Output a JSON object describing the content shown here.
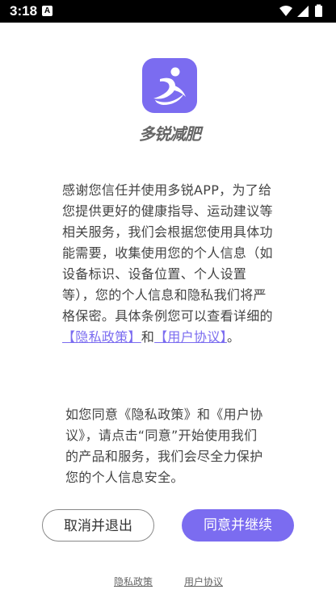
{
  "status_bar": {
    "time": "3:18",
    "notification_icon_letter": "A",
    "icons": [
      "wifi-icon",
      "signal-icon",
      "battery-icon"
    ]
  },
  "app": {
    "brand_name": "多锐减肥",
    "accent_color": "#7b6cf0"
  },
  "intro": {
    "text_before": "感谢您信任并使用多锐APP，为了给您提供更好的健康指导、运动建议等相关服务，我们会根据您使用具体功能需要，收集使用您的个人信息（如设备标识、设备位置、个人设置等），您的个人信息和隐私我们将严格保密。具体条例您可以查看详细的",
    "privacy_link": "【隐私政策】",
    "conjunction": "和",
    "user_link": "【用户协议】",
    "text_after": "。"
  },
  "consent": {
    "text": "如您同意《隐私政策》和《用户协议》，请点击“同意”开始使用我们的产品和服务，我们会尽全力保护您的个人信息安全。"
  },
  "buttons": {
    "cancel_label": "取消并退出",
    "agree_label": "同意并继续"
  },
  "footer": {
    "privacy_label": "隐私政策",
    "user_label": "用户协议"
  }
}
